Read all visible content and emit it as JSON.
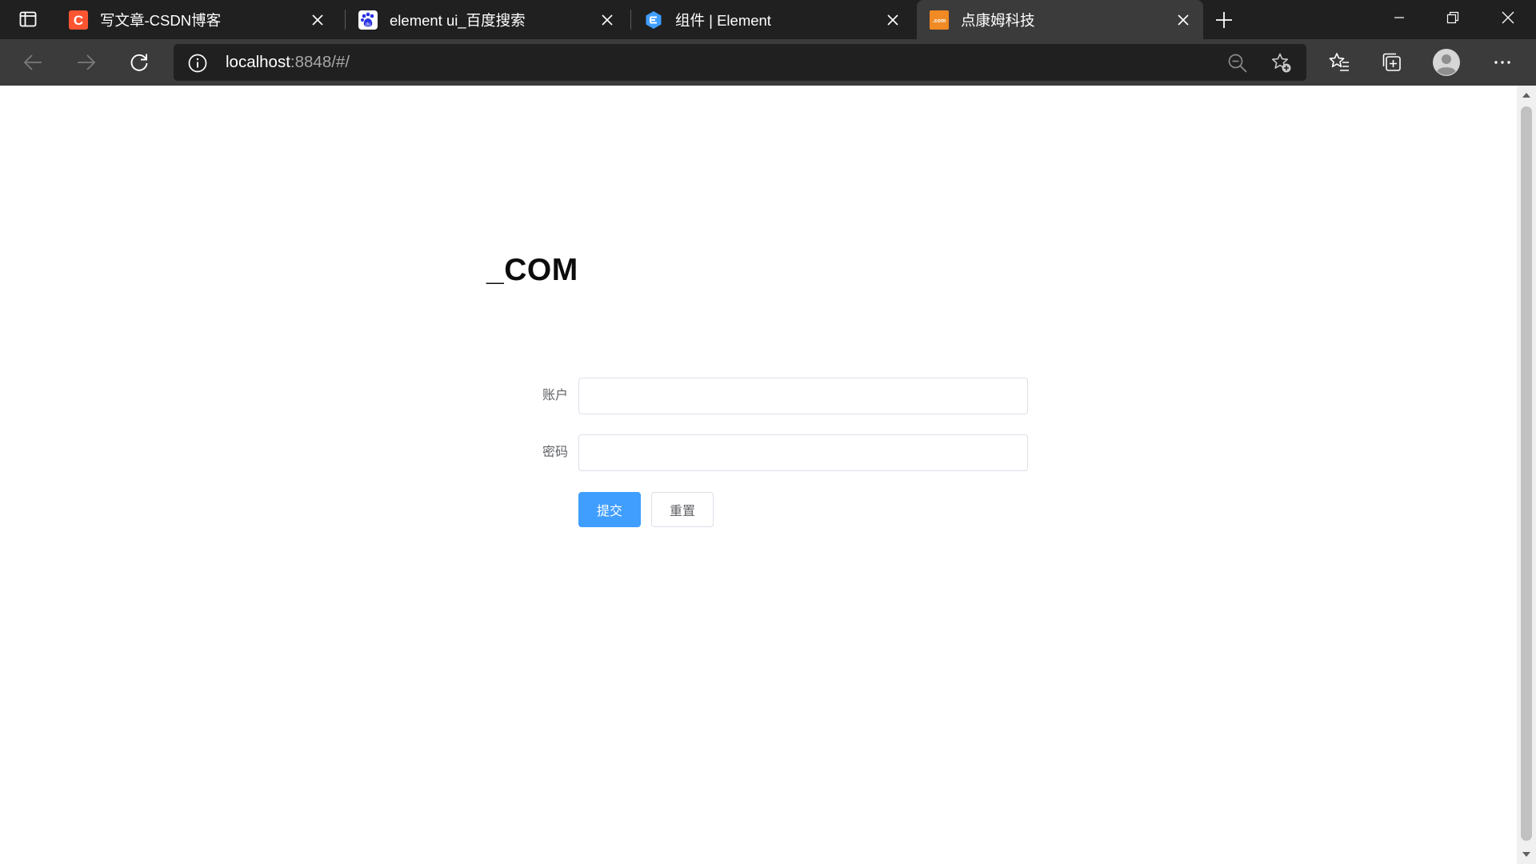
{
  "browser": {
    "tabs": [
      {
        "title": "写文章-CSDN博客",
        "favicon": "csdn-icon",
        "active": false
      },
      {
        "title": "element ui_百度搜索",
        "favicon": "baidu-icon",
        "active": false
      },
      {
        "title": "组件 | Element",
        "favicon": "element-icon",
        "active": false
      },
      {
        "title": "点康姆科技",
        "favicon": "dotcom-icon",
        "active": true
      }
    ],
    "address": {
      "host": "localhost",
      "rest": ":8848/#/"
    },
    "colors": {
      "tabstrip": "#202020",
      "toolbar": "#3b3b3b",
      "csdn": "#fc5531",
      "baidu": "#2932e1",
      "element": "#409eff",
      "dotcom": "#f08a24"
    }
  },
  "page": {
    "brand": "_COM",
    "form": {
      "account_label": "账户",
      "password_label": "密码",
      "account_value": "",
      "password_value": ""
    },
    "buttons": {
      "submit": "提交",
      "reset": "重置"
    },
    "colors": {
      "primary": "#409eff",
      "label": "#606266",
      "border": "#dcdfe6"
    }
  }
}
